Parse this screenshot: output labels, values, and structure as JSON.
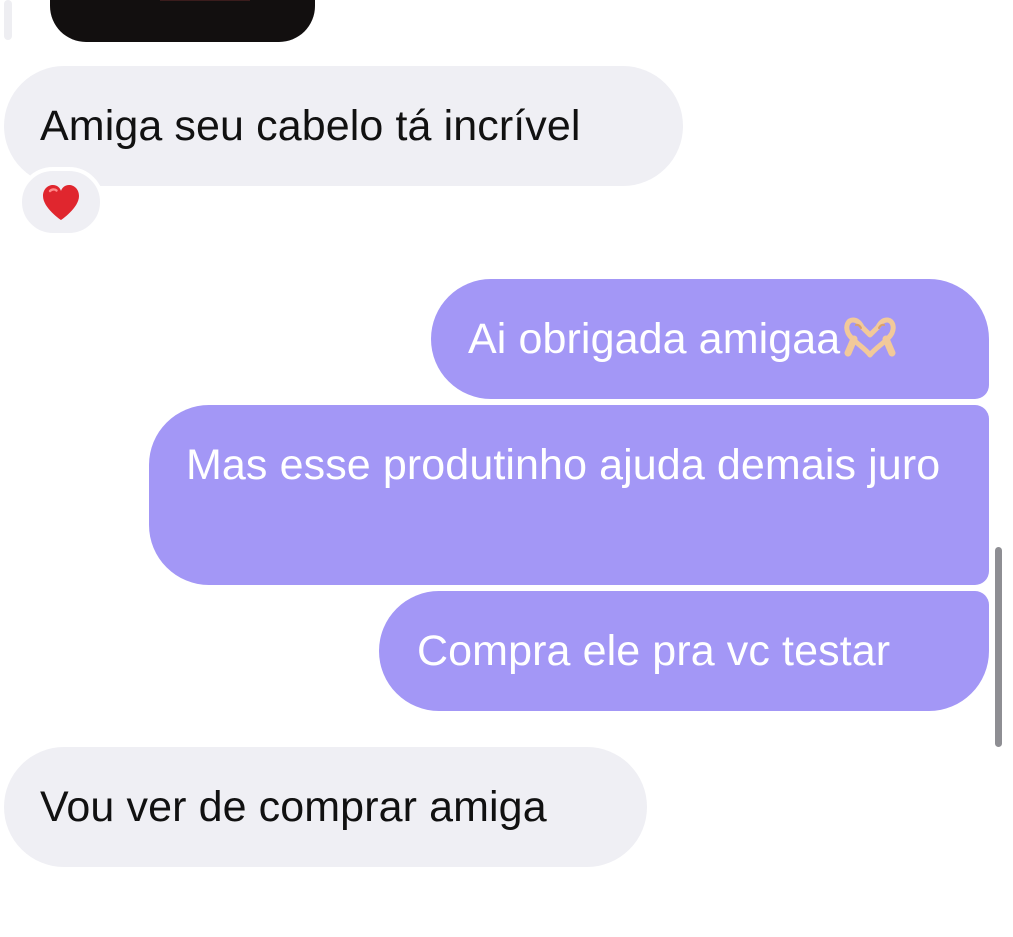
{
  "conversation": {
    "messages": [
      {
        "direction": "incoming",
        "text": "Amiga seu cabelo tá incrível",
        "reaction": "heart"
      },
      {
        "direction": "outgoing",
        "text": "Ai obrigada amigaa",
        "emoji": "heart-hands"
      },
      {
        "direction": "outgoing",
        "text": "Mas esse produtinho ajuda demais juro"
      },
      {
        "direction": "outgoing",
        "text": "Compra ele pra vc testar"
      },
      {
        "direction": "incoming",
        "text": "Vou ver de comprar amiga"
      }
    ]
  },
  "colors": {
    "outgoing_bubble": "#a397f6",
    "incoming_bubble": "#efeff4",
    "reaction_heart": "#e0262e",
    "background": "#ffffff"
  }
}
